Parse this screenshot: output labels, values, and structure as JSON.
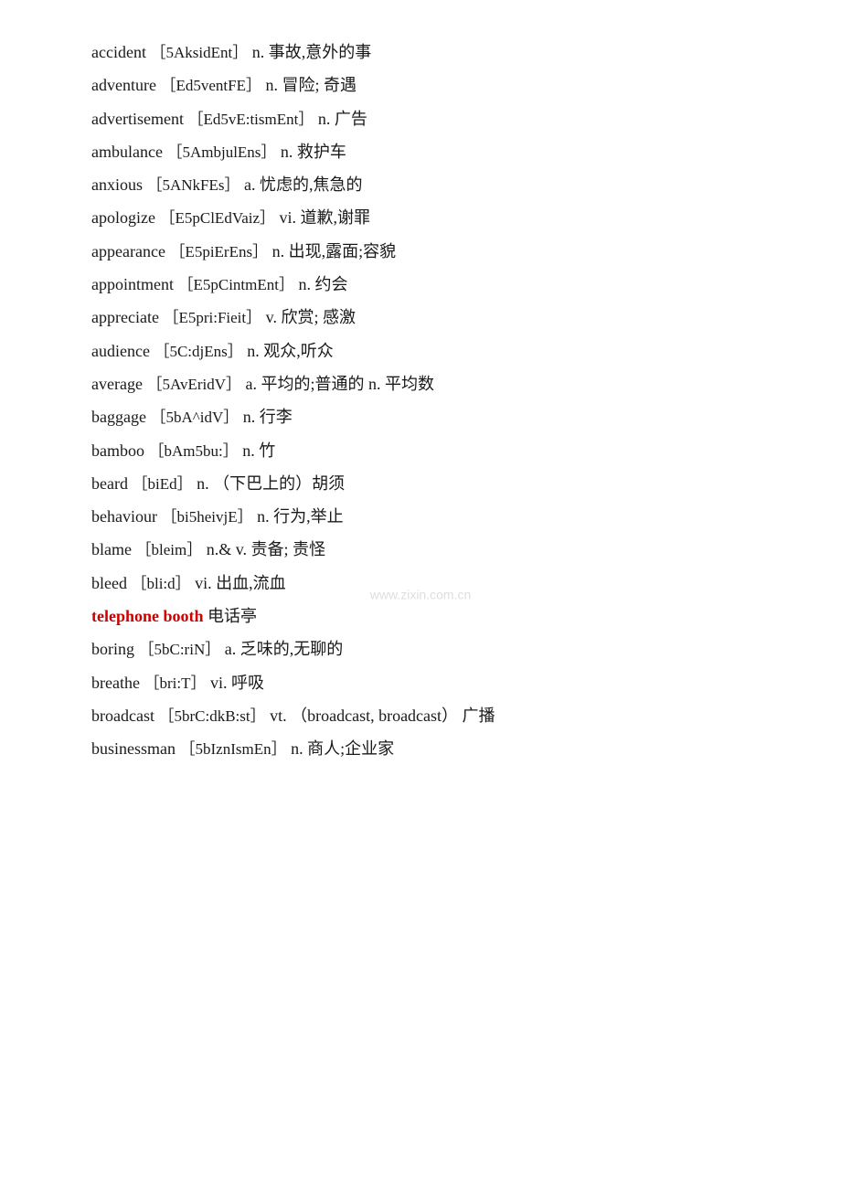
{
  "watermark": "www.zixin.com.cn",
  "entries": [
    {
      "id": "accident",
      "word": "accident",
      "phonetic": "［5AksidEnt］",
      "pos": "n.",
      "definition": "事故,意外的事",
      "highlight": false
    },
    {
      "id": "adventure",
      "word": "adventure",
      "phonetic": "［Ed5ventFE］",
      "pos": "n.",
      "definition": "冒险; 奇遇",
      "highlight": false
    },
    {
      "id": "advertisement",
      "word": "advertisement",
      "phonetic": "［Ed5vE:tismEnt］",
      "pos": "n.",
      "definition": "广告",
      "highlight": false
    },
    {
      "id": "ambulance",
      "word": "ambulance",
      "phonetic": "［5AmbjulEns］",
      "pos": "n.",
      "definition": "救护车",
      "highlight": false
    },
    {
      "id": "anxious",
      "word": "anxious",
      "phonetic": "［5ANkFEs］",
      "pos": "a.",
      "definition": "忧虑的,焦急的",
      "highlight": false
    },
    {
      "id": "apologize",
      "word": "apologize",
      "phonetic": "［E5pClEdVaiz］",
      "pos": "vi.",
      "definition": "道歉,谢罪",
      "highlight": false
    },
    {
      "id": "appearance",
      "word": "appearance",
      "phonetic": "［E5piErEns］",
      "pos": "n.",
      "definition": "出现,露面;容貌",
      "highlight": false
    },
    {
      "id": "appointment",
      "word": "appointment",
      "phonetic": "［E5pCintmEnt］",
      "pos": "n.",
      "definition": "约会",
      "highlight": false
    },
    {
      "id": "appreciate",
      "word": "appreciate",
      "phonetic": "［E5pri:Fieit］",
      "pos": "v.",
      "definition": "欣赏; 感激",
      "highlight": false
    },
    {
      "id": "audience",
      "word": "audience",
      "phonetic": "［5C:djEns］",
      "pos": "n.",
      "definition": "观众,听众",
      "highlight": false
    },
    {
      "id": "average",
      "word": "average",
      "phonetic": "［5AvEridV］",
      "pos": "a.",
      "definition": "平均的;普通的 n. 平均数",
      "highlight": false
    },
    {
      "id": "baggage",
      "word": "baggage",
      "phonetic": "［5bA^idV］",
      "pos": "n.",
      "definition": "行李",
      "highlight": false
    },
    {
      "id": "bamboo",
      "word": "bamboo",
      "phonetic": "［bAm5bu:］",
      "pos": "n.",
      "definition": "竹",
      "highlight": false
    },
    {
      "id": "beard",
      "word": "beard",
      "phonetic": "［biEd］",
      "pos": "n.",
      "definition": "（下巴上的）胡须",
      "highlight": false
    },
    {
      "id": "behaviour",
      "word": "behaviour",
      "phonetic": "［bi5heivjE］",
      "pos": "n.",
      "definition": "行为,举止",
      "highlight": false
    },
    {
      "id": "blame",
      "word": "blame",
      "phonetic": "［bleim］",
      "pos": "n.& v.",
      "definition": "责备; 责怪",
      "highlight": false
    },
    {
      "id": "bleed",
      "word": "bleed",
      "phonetic": "［bli:d］",
      "pos": "vi.",
      "definition": "出血,流血",
      "highlight": false
    },
    {
      "id": "telephone_booth",
      "word": "telephone booth",
      "phonetic": "",
      "pos": "",
      "definition": "电话亭",
      "highlight": true
    },
    {
      "id": "boring",
      "word": "boring",
      "phonetic": "［5bC:riN］",
      "pos": "a.",
      "definition": "乏味的,无聊的",
      "highlight": false
    },
    {
      "id": "breathe",
      "word": "breathe",
      "phonetic": "［bri:T］",
      "pos": "vi.",
      "definition": "呼吸",
      "highlight": false
    },
    {
      "id": "broadcast",
      "word": "broadcast",
      "phonetic": "［5brC:dkB:st］",
      "pos": "vt.",
      "definition": "（broadcast, broadcast） 广播",
      "highlight": false
    },
    {
      "id": "businessman",
      "word": "businessman",
      "phonetic": "［5bIznIsmEn］",
      "pos": "n.",
      "definition": "商人;企业家",
      "highlight": false
    }
  ]
}
